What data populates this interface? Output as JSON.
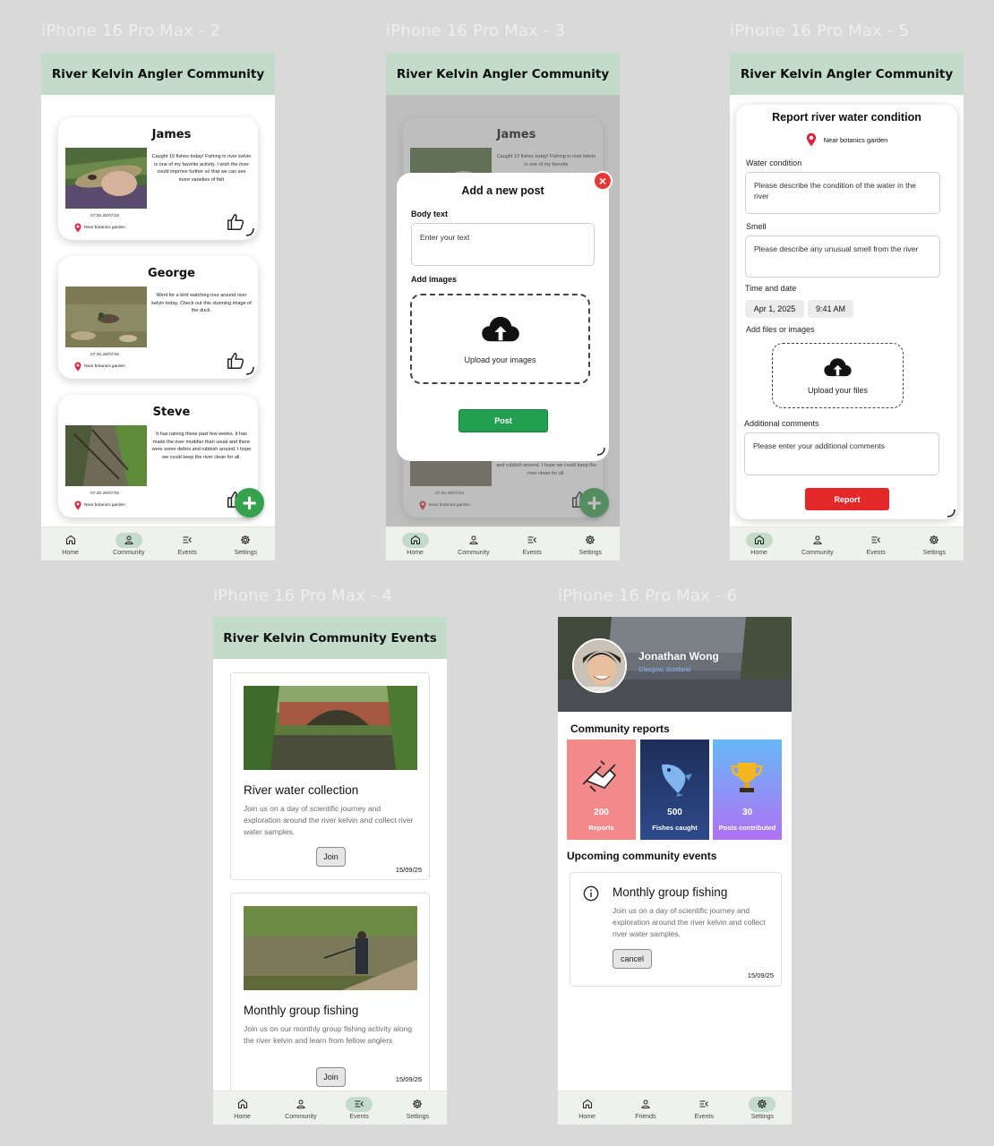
{
  "colors": {
    "header": "#c2dcc9",
    "nav_bg": "#eef1ec",
    "fab": "#37a24e",
    "post_button": "#22a04f",
    "report_button": "#e22828",
    "close_button": "#e53935",
    "pin": "#e0223f"
  },
  "nav_default": [
    {
      "label": "Home",
      "icon": "home-icon"
    },
    {
      "label": "Community",
      "icon": "person-icon"
    },
    {
      "label": "Events",
      "icon": "events-icon"
    },
    {
      "label": "Settings",
      "icon": "gear-icon"
    }
  ],
  "frames": {
    "f2": {
      "label": "iPhone 16 Pro Max - 2",
      "header": "River Kelvin Angler Community",
      "active_nav": "Community",
      "posts": [
        {
          "name": "James",
          "text": "Caught 10 fishes today! Fishing in river kelvin is one of my favorite activity. I wish the river could improve further so that we can see more varieties of fish",
          "time": "07:35 28/07/25",
          "location": "Near botanics garden"
        },
        {
          "name": "George",
          "text": "Went for a bird watching tour around river kelvin today. Check out this stunning image of the duck.",
          "time": "07:35 28/07/25",
          "location": "Near botanics garden"
        },
        {
          "name": "Steve",
          "text": "It has raining these past few weeks, it has made the river muddier than usual and there were some debris and rubbish around. I hope we could keep the river clean for all.",
          "time": "07:35 28/07/25",
          "location": "Near botanics garden"
        }
      ],
      "fab": "+"
    },
    "f3": {
      "label": "iPhone 16 Pro Max - 3",
      "header": "River Kelvin Angler Community",
      "active_nav": "Home",
      "bg_name": "James",
      "bg_text_top": "Caught 10 fishes today! Fishing in river kelvin is one of my favorite",
      "bg_text_bottom": "and rubbish around. I hope we could keep the river clean for all.",
      "bg_time": "07:35 28/07/25",
      "bg_location": "Near botanics garden",
      "modal": {
        "title": "Add a new post",
        "close": "×",
        "body_label": "Body text",
        "body_placeholder": "Enter your text",
        "images_label": "Add images",
        "upload_text": "Upload your images",
        "post_button": "Post"
      }
    },
    "f5": {
      "label": "iPhone 16 Pro Max - 5",
      "header": "River Kelvin Angler Community",
      "active_nav": "Home",
      "title": "Report river water condition",
      "location": "Near botanics garden",
      "water_label": "Water condition",
      "water_placeholder": "Please describe the condition of the water in the river",
      "smell_label": "Smell",
      "smell_placeholder": "Please describe any unusual smell from the river",
      "time_label": "Time and date",
      "date": "Apr 1, 2025",
      "time": "9:41 AM",
      "files_label": "Add files or images",
      "upload_text": "Upload your files",
      "comments_label": "Additional comments",
      "comments_placeholder": "Please enter your additional comments",
      "report_button": "Report"
    },
    "f4": {
      "label": "iPhone 16 Pro Max - 4",
      "header": "River Kelvin Community Events",
      "active_nav": "Events",
      "events": [
        {
          "title": "River water collection",
          "desc": "Join us on a day of scientific journey and exploration around the river kelvin and collect river water samples.",
          "button": "Join",
          "date": "15/09/25"
        },
        {
          "title": "Monthly group fishing",
          "desc": "Join us on our monthly group fishing activity along the river kelvin and learn from fellow anglers",
          "button": "Join",
          "date": "15/09/25"
        }
      ]
    },
    "f6": {
      "label": "iPhone 16 Pro Max - 6",
      "name": "Jonathan Wong",
      "location": "Glasgow, Scotland",
      "reports_title": "Community reports",
      "stats": [
        {
          "value": "200",
          "label": "Reports",
          "color": "#f27d7d"
        },
        {
          "value": "500",
          "label": "Fishes caught",
          "color": "#223a6e"
        },
        {
          "value": "30",
          "label": "Posts contributed",
          "color": "#9f6ef0"
        }
      ],
      "events_title": "Upcoming community events",
      "event": {
        "title": "Monthly group fishing",
        "desc": "Join us on a day of scientific journey and exploration around the river kelvin and collect river water samples.",
        "button": "cancel",
        "date": "15/09/25"
      },
      "active_nav": "Settings",
      "nav": [
        {
          "label": "Home",
          "icon": "home-icon"
        },
        {
          "label": "Friends",
          "icon": "person-icon"
        },
        {
          "label": "Events",
          "icon": "events-icon"
        },
        {
          "label": "Settings",
          "icon": "gear-icon"
        }
      ]
    }
  }
}
